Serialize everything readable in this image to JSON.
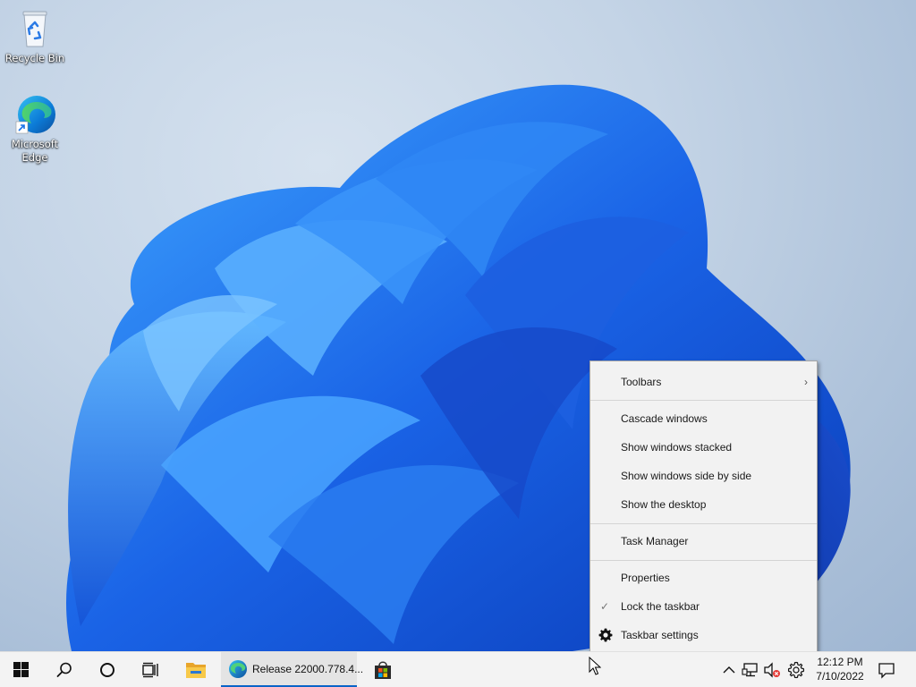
{
  "desktop": {
    "icons": [
      {
        "label": "Recycle Bin",
        "icon": "recycle-bin-icon"
      },
      {
        "label": "Microsoft Edge",
        "icon": "edge-icon"
      }
    ]
  },
  "context_menu": {
    "items": [
      {
        "label": "Toolbars",
        "submenu": true
      },
      {
        "label": "Cascade windows"
      },
      {
        "label": "Show windows stacked"
      },
      {
        "label": "Show windows side by side"
      },
      {
        "label": "Show the desktop"
      },
      {
        "label": "Task Manager"
      },
      {
        "label": "Properties"
      },
      {
        "label": "Lock the taskbar",
        "checked": true
      },
      {
        "label": "Taskbar settings",
        "icon": "gear-icon"
      }
    ],
    "chevron": "›",
    "checkmark": "✓"
  },
  "taskbar": {
    "start_icon": "windows-logo-icon",
    "search_icon": "search-icon",
    "cortana_icon": "cortana-circle-icon",
    "task_view_icon": "task-view-icon",
    "pinned": [
      {
        "icon": "file-explorer-icon"
      },
      {
        "label": "Release 22000.778.4...",
        "icon": "edge-icon",
        "active": true
      },
      {
        "icon": "microsoft-store-icon"
      }
    ],
    "tray": {
      "icons": [
        "chevron-up-icon",
        "network-icon",
        "volume-muted-icon",
        "gear-icon"
      ],
      "time": "12:12 PM",
      "date": "7/10/2022",
      "notification_icon": "notification-icon"
    }
  },
  "colors": {
    "accent": "#0a64c8",
    "taskbar_bg": "#f3f3f3",
    "menu_bg": "#f2f2f2",
    "bloom_blue": "#1a63e6"
  }
}
